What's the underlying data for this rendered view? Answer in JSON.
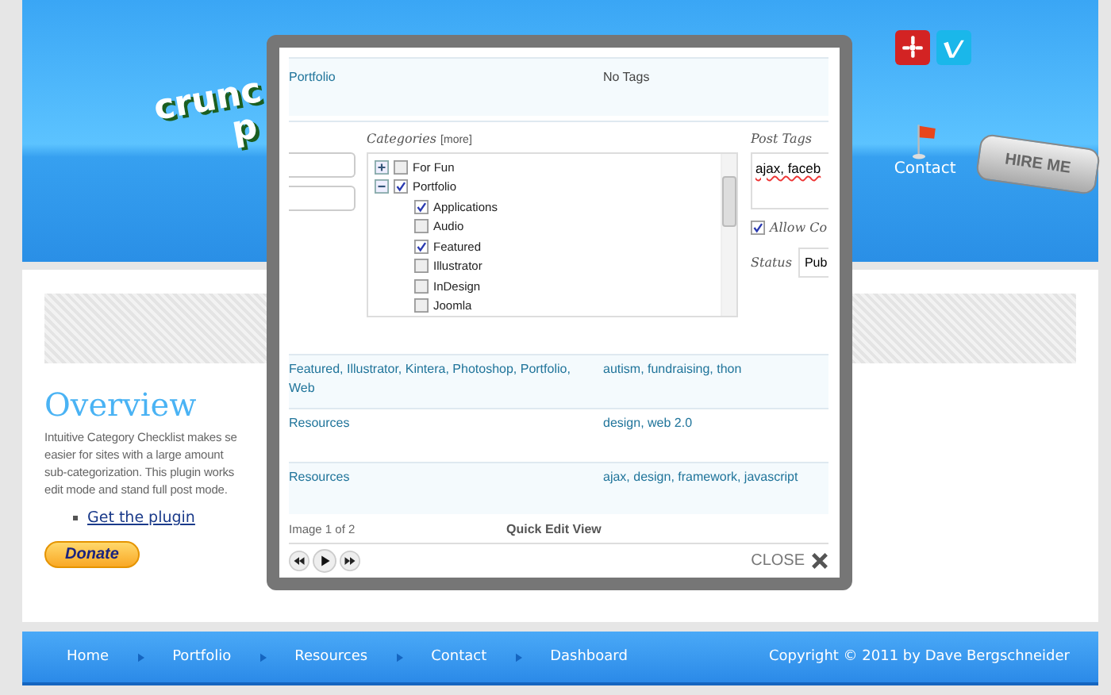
{
  "header": {
    "logo": [
      "crunc",
      "p"
    ],
    "social_icons": [
      {
        "kind": "yelp"
      },
      {
        "kind": "vimeo"
      }
    ],
    "nav_item": "Contact",
    "hire_button": "HIRE ME"
  },
  "content": {
    "heading": "Overview",
    "paragraph": [
      "Intuitive Category Checklist makes se",
      "easier for sites with a large amount",
      "sub-categorization. This plugin works",
      "edit mode and stand full post mode."
    ],
    "links": [
      "Get the plugin"
    ],
    "donate_button": "Donate"
  },
  "lightbox": {
    "top_row": {
      "categories": "Portfolio",
      "tags": "No Tags"
    },
    "edit": {
      "categories_label": "Categories",
      "more_link": "[more]",
      "tree": [
        {
          "label": "For Fun",
          "checked": false,
          "expanded": false
        },
        {
          "label": "Portfolio",
          "checked": true,
          "expanded": true,
          "children": [
            {
              "label": "Applications",
              "checked": true
            },
            {
              "label": "Audio",
              "checked": false
            },
            {
              "label": "Featured",
              "checked": true
            },
            {
              "label": "Illustrator",
              "checked": false
            },
            {
              "label": "InDesign",
              "checked": false
            },
            {
              "label": "Joomla",
              "checked": false
            }
          ]
        }
      ],
      "tags_label": "Post Tags",
      "tags_value": "ajax, faceb",
      "allow_label": "Allow Co",
      "allow_checked": true,
      "status_label": "Status",
      "status_value": "Pub"
    },
    "rows": [
      {
        "categories": "Featured, Illustrator, Kintera, Photoshop, Portfolio, Web",
        "tags": "autism, fundraising, thon"
      },
      {
        "categories": "Resources",
        "tags": "design, web 2.0"
      },
      {
        "categories": "Resources",
        "tags": "ajax, design, framework, javascript"
      }
    ],
    "counter": "Image 1 of 2",
    "title": "Quick Edit View",
    "close": "CLOSE"
  },
  "footer": {
    "nav": [
      "Home",
      "Portfolio",
      "Resources",
      "Contact",
      "Dashboard"
    ],
    "copyright": "Copyright © 2011 by Dave Bergschneider"
  }
}
